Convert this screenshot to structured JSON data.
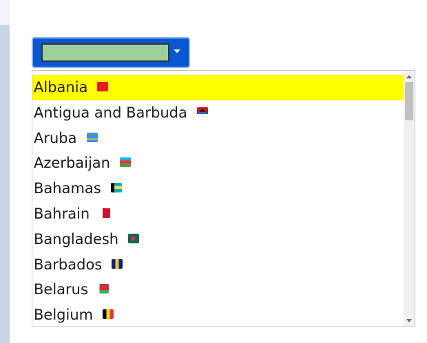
{
  "select": {
    "value": "",
    "field_color": "#9dd19b",
    "accent": "#0b57d0"
  },
  "dropdown": {
    "highlight_color": "#ffff00",
    "scroll_position": 0.0,
    "options": [
      {
        "label": "Albania",
        "flag": "albania-flag-icon",
        "highlighted": true
      },
      {
        "label": "Antigua and Barbuda",
        "flag": "antigua-and-barbuda-flag-icon",
        "highlighted": false
      },
      {
        "label": "Aruba",
        "flag": "aruba-flag-icon",
        "highlighted": false
      },
      {
        "label": "Azerbaijan",
        "flag": "azerbaijan-flag-icon",
        "highlighted": false
      },
      {
        "label": "Bahamas",
        "flag": "bahamas-flag-icon",
        "highlighted": false
      },
      {
        "label": "Bahrain",
        "flag": "bahrain-flag-icon",
        "highlighted": false
      },
      {
        "label": "Bangladesh",
        "flag": "bangladesh-flag-icon",
        "highlighted": false
      },
      {
        "label": "Barbados",
        "flag": "barbados-flag-icon",
        "highlighted": false
      },
      {
        "label": "Belarus",
        "flag": "belarus-flag-icon",
        "highlighted": false
      },
      {
        "label": "Belgium",
        "flag": "belgium-flag-icon",
        "highlighted": false
      }
    ]
  }
}
